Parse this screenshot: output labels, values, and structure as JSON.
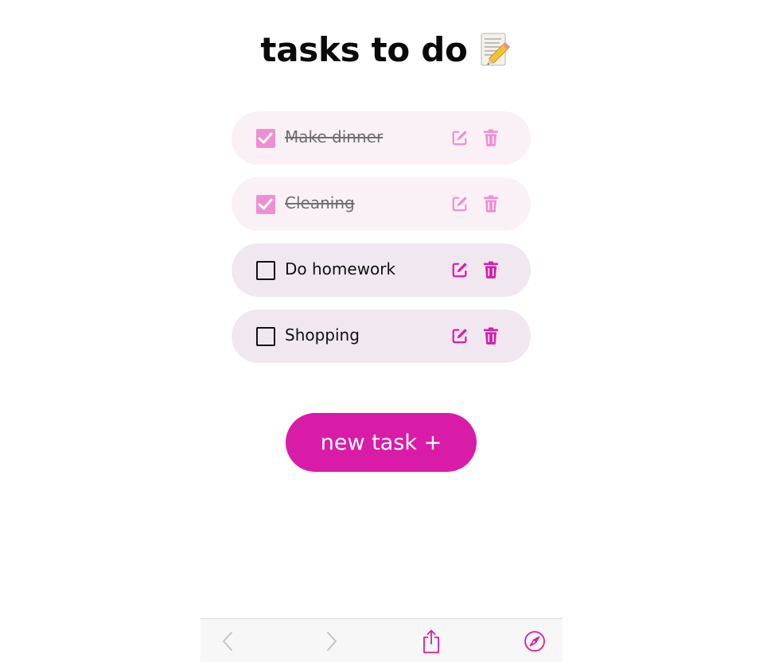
{
  "header": {
    "title": "tasks to do",
    "title_icon": "memo-icon"
  },
  "tasks": [
    {
      "label": "Make dinner",
      "completed": true,
      "edit_icon": "edit-icon",
      "delete_icon": "trash-icon"
    },
    {
      "label": "Cleaning",
      "completed": true,
      "edit_icon": "edit-icon",
      "delete_icon": "trash-icon"
    },
    {
      "label": "Do homework",
      "completed": false,
      "edit_icon": "edit-icon",
      "delete_icon": "trash-icon"
    },
    {
      "label": "Shopping",
      "completed": false,
      "edit_icon": "edit-icon",
      "delete_icon": "trash-icon"
    }
  ],
  "new_task_button": {
    "label": "new task +"
  },
  "browser_toolbar": {
    "icons": [
      "back-icon",
      "forward-icon",
      "share-icon",
      "compass-icon"
    ]
  },
  "colors": {
    "accent": "#d91ca8",
    "accent_muted": "#ef8fd2",
    "completed_row_bg": "#faf1f6",
    "open_row_bg": "#f0e7f0"
  }
}
